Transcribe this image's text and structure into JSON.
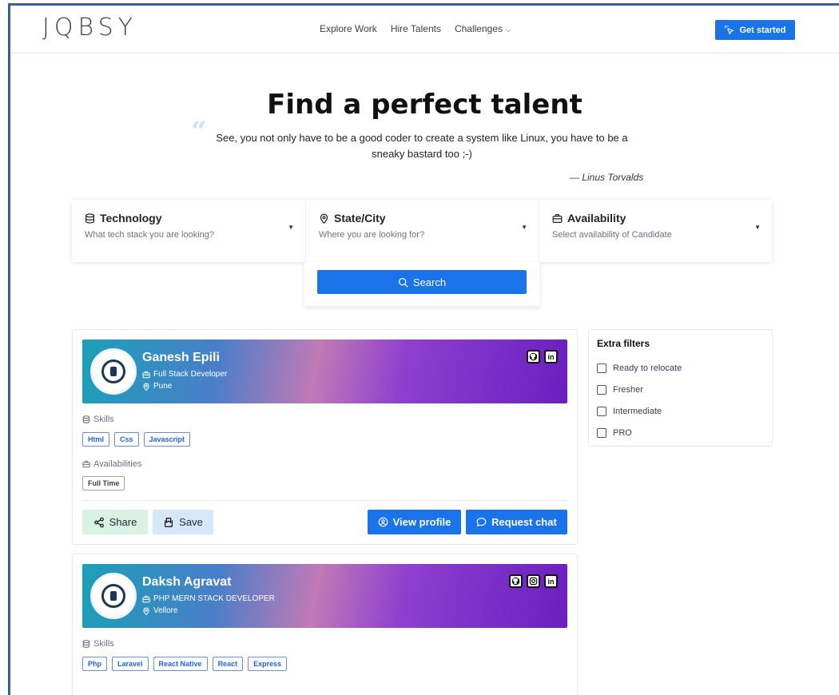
{
  "brand": {
    "logo": "JQBSY"
  },
  "nav": {
    "links": [
      "Explore Work",
      "Hire Talents",
      "Challenges"
    ],
    "cta": "Get started"
  },
  "hero": {
    "title": "Find a perfect talent",
    "quote": "See, you not only have to be a good coder to create a system like Linux, you have to be a sneaky bastard too ;-)",
    "author": "— Linus Torvalds"
  },
  "search": {
    "fields": [
      {
        "label": "Technology",
        "placeholder": "What tech stack you are looking?"
      },
      {
        "label": "State/City",
        "placeholder": "Where you are looking for?"
      },
      {
        "label": "Availability",
        "placeholder": "Select availability of Candidate"
      }
    ],
    "button": "Search"
  },
  "cards": [
    {
      "name": "Ganesh Epili",
      "role": "Full Stack Developer",
      "city": "Pune",
      "skills_label": "Skills",
      "skills": [
        "Html",
        "Css",
        "Javascript"
      ],
      "avail_label": "Availabilities",
      "availabilities": [
        "Full Time"
      ],
      "actions": {
        "share": "Share",
        "save": "Save",
        "view": "View profile",
        "chat": "Request chat"
      }
    },
    {
      "name": "Daksh Agravat",
      "role": "PHP MERN STACK DEVELOPER",
      "city": "Vellore",
      "skills_label": "Skills",
      "skills": [
        "Php",
        "Laravel",
        "React Native",
        "React",
        "Express"
      ]
    }
  ],
  "filters": {
    "title": "Extra filters",
    "options": [
      "Ready to relocate",
      "Fresher",
      "Intermediate",
      "PRO"
    ]
  },
  "colors": {
    "primary": "#1a73e8",
    "share_bg": "#d9f2e3",
    "save_bg": "#d6e7fb"
  }
}
